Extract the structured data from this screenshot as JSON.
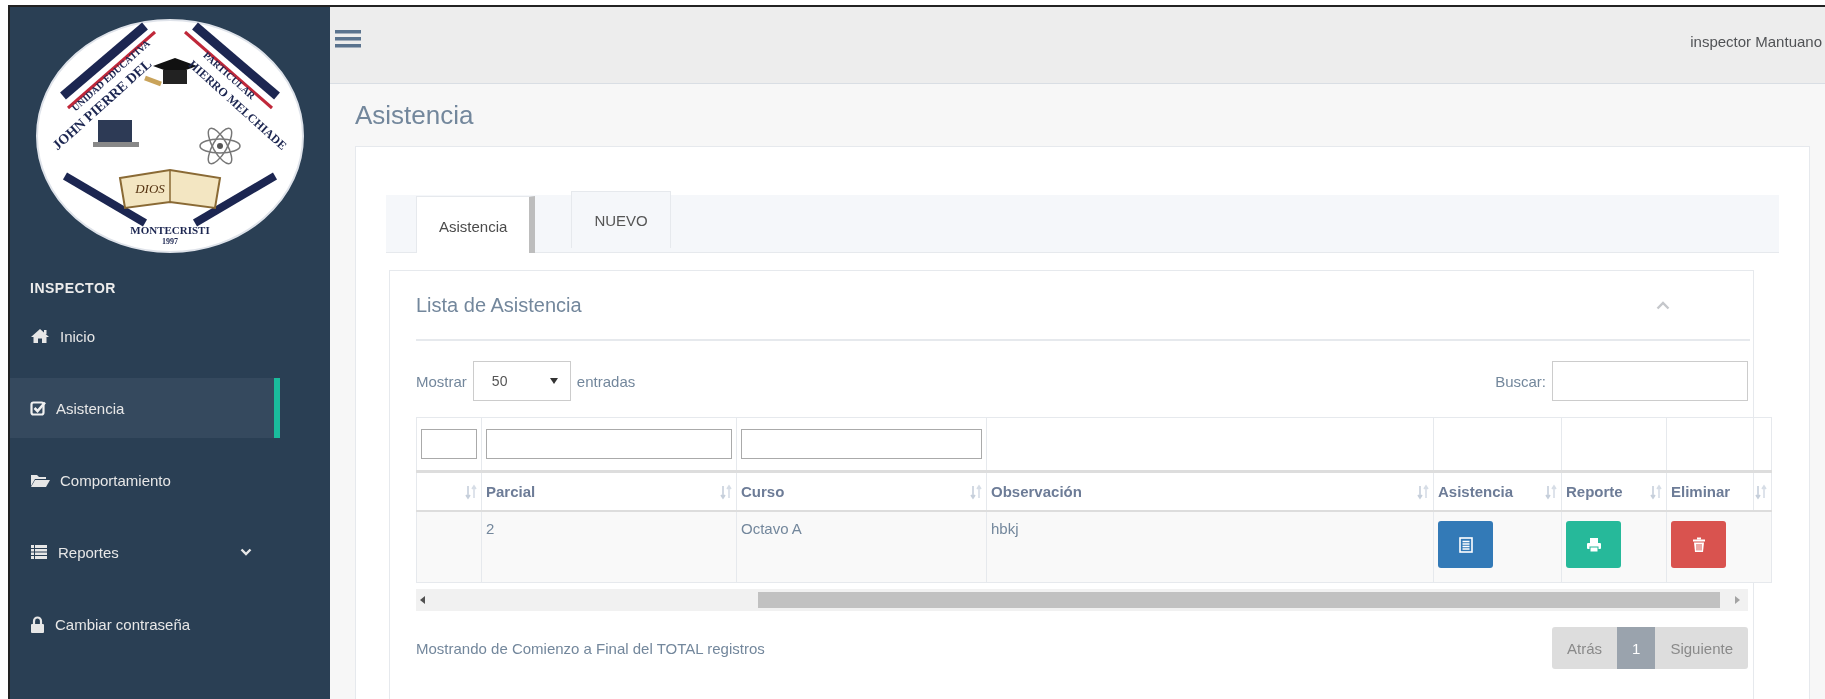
{
  "sidebar": {
    "logo": {
      "texts": [
        "UNIDAD EDUCATIVA",
        "JOHN PIERRE DEL",
        "PARTICULAR",
        "HIERRO MELCHIADE",
        "DIOS",
        "MONTECRISTI",
        "1997"
      ]
    },
    "section_title": "INSPECTOR",
    "items": [
      {
        "label": "Inicio",
        "kind": "home",
        "selected": false,
        "expandable": false
      },
      {
        "label": "Asistencia",
        "kind": "check",
        "selected": true,
        "expandable": false
      },
      {
        "label": "Comportamiento",
        "kind": "folder",
        "selected": false,
        "expandable": false
      },
      {
        "label": "Reportes",
        "kind": "list",
        "selected": false,
        "expandable": true
      },
      {
        "label": "Cambiar contraseña",
        "kind": "lock",
        "selected": false,
        "expandable": false
      }
    ]
  },
  "top_bar": {
    "user": "inspector Mantuano"
  },
  "page_title": "Asistencia",
  "tabs": [
    {
      "label": "Asistencia",
      "selected": true
    },
    {
      "label": "NUEVO",
      "selected": false
    }
  ],
  "panel": {
    "title": "Lista de Asistencia",
    "expanded": true
  },
  "length_menu": {
    "label_before": "Mostrar",
    "value": "50",
    "label_after": "entradas"
  },
  "search": {
    "label": "Buscar:"
  },
  "table": {
    "columns": [
      {
        "filter": true
      },
      {
        "label": "Parcial",
        "filter": true
      },
      {
        "label": "Curso",
        "filter": true
      },
      {
        "label": "Observación",
        "filter": false
      },
      {
        "label": "Asistencia",
        "filter": false
      },
      {
        "label": "Reporte",
        "filter": false
      },
      {
        "label": "Eliminar",
        "filter": false
      }
    ],
    "rows": [
      {
        "cells": [
          {
            "kind": "blank"
          },
          {
            "kind": "text",
            "text": "2"
          },
          {
            "kind": "text",
            "text": "Octavo A"
          },
          {
            "kind": "text",
            "text": "hbkj"
          },
          {
            "kind": "list"
          },
          {
            "kind": "print"
          },
          {
            "kind": "delete"
          }
        ]
      }
    ]
  },
  "info": "Mostrando de Comienzo a Final del TOTAL registros",
  "pagination": [
    {
      "label": "Atrás",
      "selected": false,
      "disabled": true
    },
    {
      "label": "1",
      "selected": true,
      "disabled": false
    },
    {
      "label": "Siguiente",
      "selected": false,
      "disabled": true
    }
  ]
}
